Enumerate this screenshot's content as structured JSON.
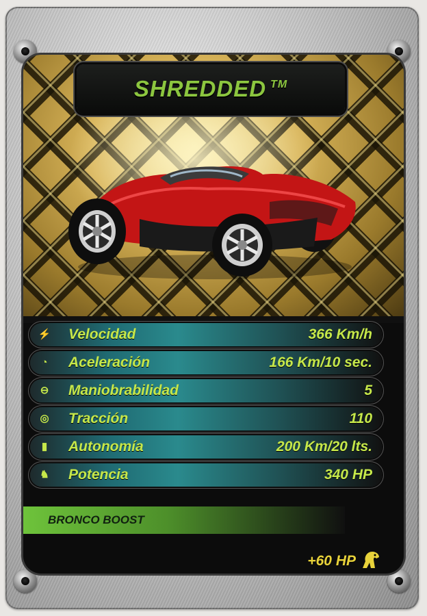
{
  "card": {
    "title": "SHREDDED",
    "trademark": "TM",
    "image_subject": "red sports car"
  },
  "stats": [
    {
      "icon": "lightning-icon",
      "label": "Velocidad",
      "value": "366 Km/h"
    },
    {
      "icon": "gauge-icon",
      "label": "Aceleración",
      "value": "166 Km/10 sec."
    },
    {
      "icon": "steering-wheel-icon",
      "label": "Maniobrabilidad",
      "value": "5"
    },
    {
      "icon": "tire-icon",
      "label": "Tracción",
      "value": "110"
    },
    {
      "icon": "fuel-can-icon",
      "label": "Autonomía",
      "value": "200 Km/20 lts."
    },
    {
      "icon": "horse-icon",
      "label": "Potencia",
      "value": "340 HP"
    }
  ],
  "bonus": {
    "name": "BRONCO BOOST",
    "value": "+60 HP",
    "icon": "horse-icon"
  },
  "colors": {
    "accent_green": "#8cc63f",
    "stat_text": "#c6e84a",
    "bonus_value": "#e8d23a",
    "bonus_bar": "#6ec33b"
  }
}
